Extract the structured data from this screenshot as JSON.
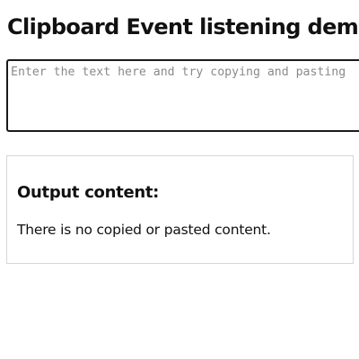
{
  "page": {
    "title": "Clipboard Event listening demo"
  },
  "input": {
    "placeholder": "Enter the text here and try copying and pasting",
    "value": ""
  },
  "output": {
    "heading": "Output content:",
    "text": "There is no copied or pasted content."
  },
  "colors": {
    "text": "#111111",
    "placeholder": "#8a8a8a",
    "input_border": "#1a1a1a",
    "panel_border": "#d6d6d6",
    "background": "#ffffff"
  }
}
